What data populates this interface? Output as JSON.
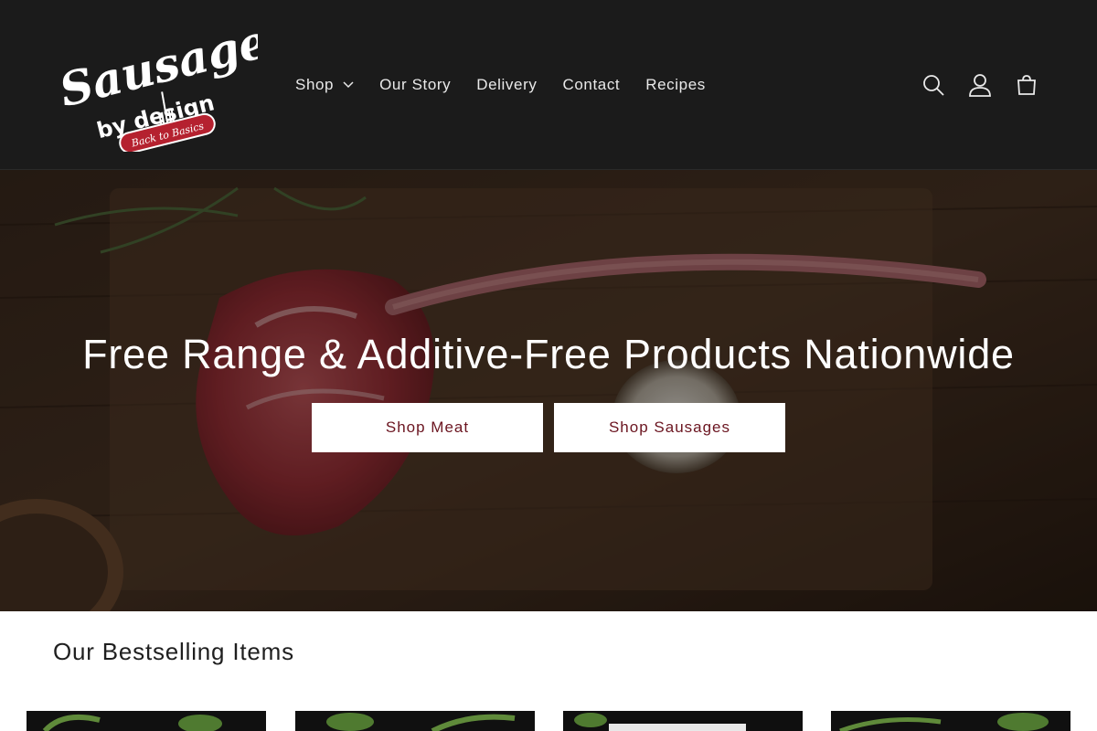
{
  "header": {
    "logo": {
      "title_word": "Sausages",
      "subtitle": "by design",
      "tagline": "Back to Basics"
    },
    "nav": [
      {
        "label": "Shop",
        "has_dropdown": true
      },
      {
        "label": "Our Story"
      },
      {
        "label": "Delivery"
      },
      {
        "label": "Contact"
      },
      {
        "label": "Recipes"
      }
    ],
    "icons": [
      "search-icon",
      "account-icon",
      "cart-icon"
    ]
  },
  "hero": {
    "heading": "Free Range & Additive-Free Products Nationwide",
    "buttons": [
      {
        "label": "Shop Meat"
      },
      {
        "label": "Shop Sausages"
      }
    ]
  },
  "bestsellers": {
    "title": "Our Bestselling Items"
  },
  "colors": {
    "header_bg": "#1b1b1b",
    "button_text": "#6b1520",
    "logo_red": "#b5212f"
  }
}
